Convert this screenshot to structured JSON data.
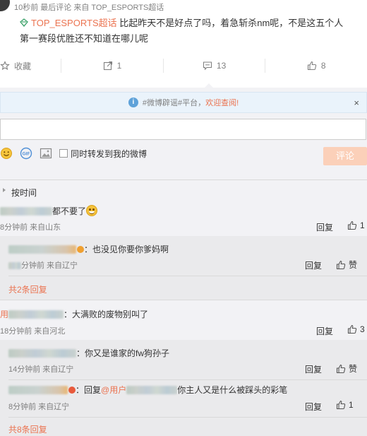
{
  "post": {
    "meta": "10秒前  最后评论 来自 TOP_ESPORTS超话",
    "topic": "TOP_ESPORTS超话",
    "text_line1": " 比起昨天不是好点了吗，着急斩杀nm呢，不是这五个人",
    "text_line2": "第一赛段优胜还不知道在哪儿呢",
    "actions": {
      "favorite": "收藏",
      "repost": "1",
      "comment": "13",
      "like": "8"
    }
  },
  "notice": {
    "prefix": "#微博辟谣#平台，",
    "link": "欢迎查阅!",
    "close": "×"
  },
  "composer": {
    "checkbox_label": "同时转发到我的微博",
    "submit": "评论"
  },
  "sort": {
    "label": "按时间"
  },
  "comments": [
    {
      "text": "都不要了",
      "time": "8分钟前  来自山东",
      "reply": "回复",
      "likes": "1",
      "replies": [
        {
          "text": "：也没见你要你爹妈啊",
          "time": "分钟前  来自辽宁",
          "reply": "回复",
          "likes": "赞"
        }
      ],
      "more": "共2条回复"
    },
    {
      "user_prefix": "用",
      "text": "：大满败的废物别叫了",
      "time": "18分钟前  来自河北",
      "reply": "回复",
      "likes": "3",
      "replies": [
        {
          "text": "：你又是谁家的fw狗孙子",
          "time": "14分钟前  来自辽宁",
          "reply": "回复",
          "likes": "赞"
        },
        {
          "prefix": "：回复",
          "mention": "@用户",
          "text": "你主人又是什么被踩头的彩笔",
          "time": "8分钟前  来自辽宁",
          "reply": "回复",
          "likes": "1"
        }
      ],
      "more": "共8条回复"
    }
  ],
  "colors": {
    "accent": "#eb7350",
    "background": "#f2f2f5",
    "sub_background": "#eaeaec",
    "notice_bg": "#eaf3fb",
    "submit_disabled": "#fbd0b9"
  }
}
